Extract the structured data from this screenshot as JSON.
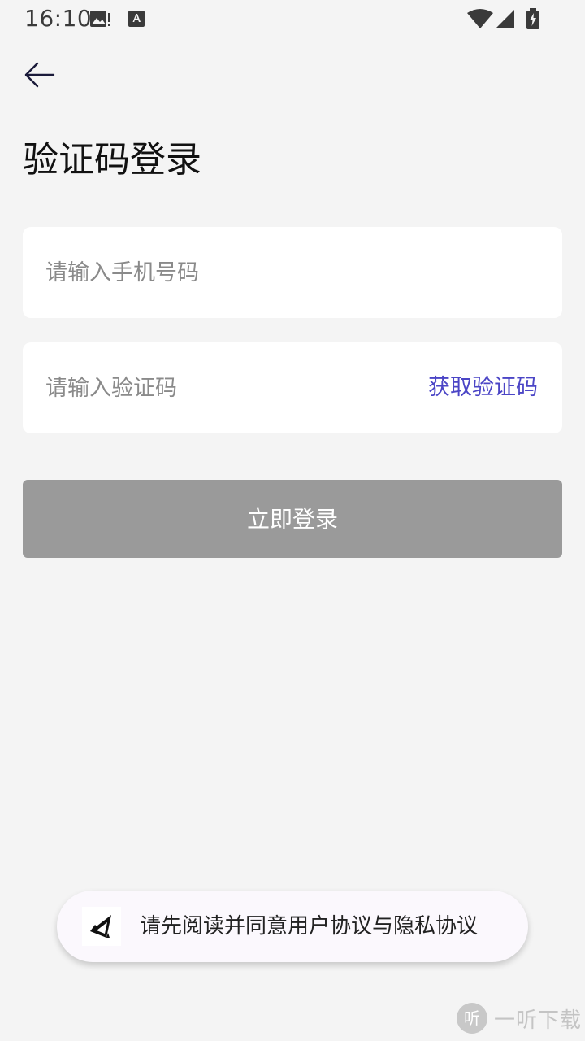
{
  "status_bar": {
    "time": "16:10",
    "icons": [
      "image-notification-icon",
      "keyboard-a-icon",
      "wifi-icon",
      "cell-signal-icon",
      "battery-charging-icon"
    ]
  },
  "header": {
    "back_icon": "arrow-left-icon",
    "title": "验证码登录"
  },
  "form": {
    "phone_placeholder": "请输入手机号码",
    "phone_value": "",
    "code_placeholder": "请输入验证码",
    "code_value": "",
    "get_code_label": "获取验证码",
    "login_label": "立即登录"
  },
  "toast": {
    "logo_icon": "app-logo-icon",
    "message": "请先阅读并同意用户协议与隐私协议"
  },
  "watermark": {
    "badge": "听",
    "text": "一听下载"
  },
  "colors": {
    "background": "#f4f4f4",
    "accent": "#4b45c6",
    "button_disabled": "#9a9a9a",
    "card": "#ffffff"
  }
}
